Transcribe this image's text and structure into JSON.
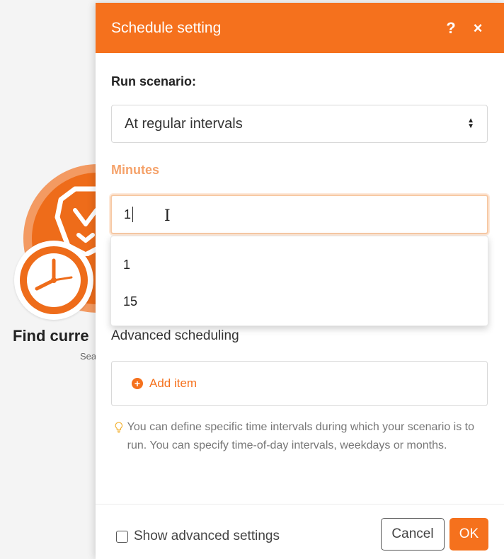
{
  "background": {
    "module_title": "Find curre",
    "module_subtitle": "Sea",
    "module_icon": "brave-lion-logo",
    "trigger_icon": "clock-icon"
  },
  "dialog": {
    "title": "Schedule setting",
    "help_label": "?",
    "close_label": "×",
    "run_label": "Run scenario:",
    "run_value": "At regular intervals",
    "minutes_label": "Minutes",
    "minutes_value": "1",
    "dropdown_options": [
      "1",
      "15"
    ],
    "advanced_label": "Advanced scheduling",
    "add_item_label": "Add item",
    "hint_text": "You can define specific time intervals during which your scenario is to run. You can specify time-of-day intervals, weekdays or months.",
    "show_advanced_label": "Show advanced settings",
    "cancel_label": "Cancel",
    "ok_label": "OK"
  },
  "colors": {
    "accent": "#f5711d",
    "label_accent": "#f5a26a"
  }
}
